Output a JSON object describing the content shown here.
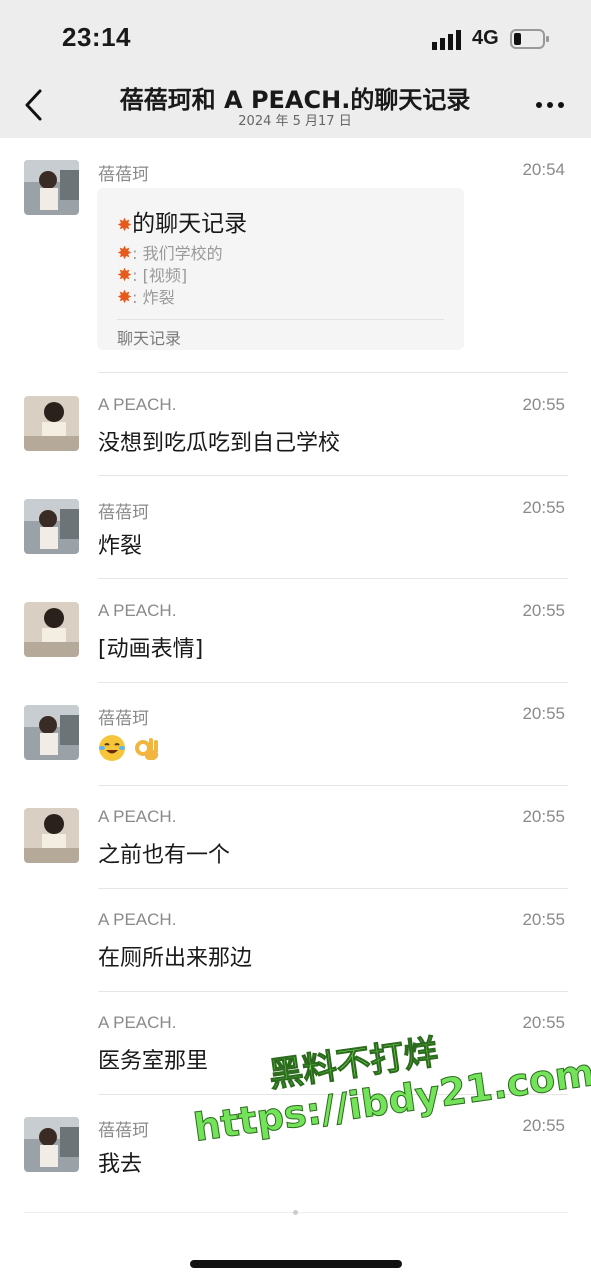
{
  "status_bar": {
    "time": "23:14",
    "network": "4G"
  },
  "header": {
    "title": "蓓蓓珂和 A PEACH.的聊天记录",
    "subtitle": "2024 年 5 月17 日"
  },
  "forwarded_card": {
    "sender": "蓓蓓珂",
    "time": "20:54",
    "title": "的聊天记录",
    "lines": [
      ": 我们学校的",
      ": [视频]",
      ": 炸裂"
    ],
    "footer": "聊天记录"
  },
  "messages": [
    {
      "sender": "A PEACH.",
      "time": "20:55",
      "text": "没想到吃瓜吃到自己学校"
    },
    {
      "sender": "蓓蓓珂",
      "time": "20:55",
      "text": "炸裂"
    },
    {
      "sender": "A PEACH.",
      "time": "20:55",
      "text": "[动画表情]"
    },
    {
      "sender": "蓓蓓珂",
      "time": "20:55",
      "text": ""
    },
    {
      "sender": "A PEACH.",
      "time": "20:55",
      "text": "之前也有一个"
    },
    {
      "sender": "A PEACH.",
      "time": "20:55",
      "text": "在厕所出来那边"
    },
    {
      "sender": "A PEACH.",
      "time": "20:55",
      "text": "医务室那里"
    },
    {
      "sender": "蓓蓓珂",
      "time": "20:55",
      "text": "我去"
    }
  ],
  "watermark": {
    "line1": "黑料不打烊",
    "line2": "https://ibdy21.com"
  },
  "colors": {
    "header_bg": "#ededed",
    "watermark": "#73e35a",
    "meta_text": "#8a8a8a"
  }
}
